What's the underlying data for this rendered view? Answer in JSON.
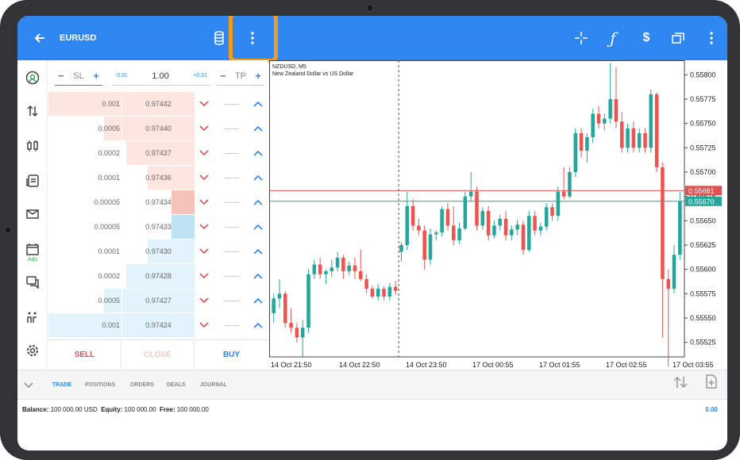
{
  "header": {
    "back_icon": "arrow-left-icon",
    "symbol": "EURUSD",
    "icons": [
      "coins-icon",
      "more-vert-icon",
      "crosshair-icon",
      "function-icon",
      "dollar-swap-icon",
      "windows-icon",
      "more-vert-icon"
    ]
  },
  "rail": {
    "icons": [
      "account-icon",
      "quotes-icon",
      "chart-icon",
      "trade-list-icon",
      "mail-icon",
      "calendar-icon",
      "chat-icon",
      "community-icon",
      "settings-icon"
    ],
    "ads_label": "Ads"
  },
  "order": {
    "sl_label": "SL",
    "tp_label": "TP",
    "minus": "−",
    "plus": "+",
    "vol_step_down": "-0.01",
    "vol_step_up": "+0.01",
    "volume": "1.00"
  },
  "book": {
    "rows": [
      {
        "volume": "0.001",
        "price": "0.97442",
        "side": "sell",
        "depth": 1.0
      },
      {
        "volume": "0.0005",
        "price": "0.97440",
        "side": "sell",
        "depth": 0.62
      },
      {
        "volume": "0.0002",
        "price": "0.97437",
        "side": "sell",
        "depth": 0.47
      },
      {
        "volume": "0.0001",
        "price": "0.97436",
        "side": "sell",
        "depth": 0.32
      },
      {
        "volume": "0.00005",
        "price": "0.97434",
        "side": "sell",
        "depth": 0.16
      },
      {
        "volume": "0.00005",
        "price": "0.97433",
        "side": "buy",
        "depth": 0.16
      },
      {
        "volume": "0.0001",
        "price": "0.97430",
        "side": "buy",
        "depth": 0.32
      },
      {
        "volume": "0.0002",
        "price": "0.97428",
        "side": "buy",
        "depth": 0.47
      },
      {
        "volume": "0.0005",
        "price": "0.97427",
        "side": "buy",
        "depth": 0.62
      },
      {
        "volume": "0.001",
        "price": "0.97424",
        "side": "buy",
        "depth": 1.0
      }
    ]
  },
  "buttons": {
    "sell": "SELL",
    "close": "CLOSE",
    "buy": "BUY"
  },
  "chart_data": {
    "type": "candlestick",
    "title": "NZDUSD, M5",
    "subtitle": "New Zealand Dollar vs US Dollar",
    "x_ticks": [
      "14 Oct 21:50",
      "14 Oct 22:50",
      "14 Oct 23:50",
      "17 Oct 00:55",
      "17 Oct 01:55",
      "17 Oct 02:55",
      "17 Oct 03:55"
    ],
    "y_ticks": [
      "0.55800",
      "0.55775",
      "0.55750",
      "0.55725",
      "0.55700",
      "0.55675",
      "0.55650",
      "0.55625",
      "0.55600",
      "0.55575",
      "0.55550",
      "0.55525"
    ],
    "ylim": [
      0.5551,
      0.55815
    ],
    "ask_line": {
      "label": "0.55681",
      "value": 0.55681,
      "color": "#e05151"
    },
    "bid_line": {
      "label": "0.55670",
      "value": 0.5567,
      "color": "#26a69a"
    },
    "session_break_index": 22,
    "colors": {
      "up": "#26a69a",
      "down": "#ef5350"
    },
    "candles": [
      [
        0.55555,
        0.55575,
        0.55545,
        0.5557
      ],
      [
        0.5557,
        0.5559,
        0.5556,
        0.55575
      ],
      [
        0.55575,
        0.55578,
        0.5554,
        0.55545
      ],
      [
        0.55545,
        0.5556,
        0.55535,
        0.5554
      ],
      [
        0.5554,
        0.55545,
        0.55525,
        0.5553
      ],
      [
        0.5553,
        0.55548,
        0.5551,
        0.5554
      ],
      [
        0.5554,
        0.556,
        0.55535,
        0.55595
      ],
      [
        0.55595,
        0.5561,
        0.5559,
        0.55605
      ],
      [
        0.55605,
        0.55612,
        0.5559,
        0.55595
      ],
      [
        0.55595,
        0.556,
        0.55585,
        0.55598
      ],
      [
        0.55598,
        0.5561,
        0.55592,
        0.55602
      ],
      [
        0.55602,
        0.55618,
        0.55598,
        0.55612
      ],
      [
        0.55612,
        0.55615,
        0.5559,
        0.55598
      ],
      [
        0.55598,
        0.55608,
        0.55594,
        0.55604
      ],
      [
        0.55604,
        0.55612,
        0.5559,
        0.55598
      ],
      [
        0.55598,
        0.5562,
        0.55588,
        0.5559
      ],
      [
        0.5559,
        0.55595,
        0.55575,
        0.5558
      ],
      [
        0.5558,
        0.55583,
        0.5557,
        0.55572
      ],
      [
        0.55572,
        0.55585,
        0.55568,
        0.5558
      ],
      [
        0.5558,
        0.55583,
        0.55568,
        0.55572
      ],
      [
        0.55572,
        0.55586,
        0.55568,
        0.55582
      ],
      [
        0.55582,
        0.55588,
        0.55574,
        0.55578
      ],
      [
        0.55618,
        0.55628,
        0.55608,
        0.55625
      ],
      [
        0.55625,
        0.5568,
        0.5562,
        0.55665
      ],
      [
        0.55665,
        0.55672,
        0.5564,
        0.55645
      ],
      [
        0.55645,
        0.55652,
        0.55635,
        0.5564
      ],
      [
        0.5564,
        0.55645,
        0.556,
        0.5561
      ],
      [
        0.5561,
        0.55642,
        0.55605,
        0.55636
      ],
      [
        0.55636,
        0.5564,
        0.5563,
        0.55638
      ],
      [
        0.55638,
        0.55665,
        0.55634,
        0.55662
      ],
      [
        0.55662,
        0.55668,
        0.5564,
        0.55645
      ],
      [
        0.55645,
        0.55665,
        0.55625,
        0.5563
      ],
      [
        0.5563,
        0.55648,
        0.55626,
        0.55642
      ],
      [
        0.55642,
        0.5568,
        0.5564,
        0.55675
      ],
      [
        0.55675,
        0.557,
        0.5567,
        0.5568
      ],
      [
        0.5568,
        0.55685,
        0.5564,
        0.55645
      ],
      [
        0.55645,
        0.55664,
        0.55641,
        0.5566
      ],
      [
        0.5566,
        0.55665,
        0.5563,
        0.55635
      ],
      [
        0.55635,
        0.5565,
        0.55632,
        0.55645
      ],
      [
        0.55645,
        0.55656,
        0.5564,
        0.55652
      ],
      [
        0.55652,
        0.5566,
        0.5563,
        0.55635
      ],
      [
        0.55635,
        0.55645,
        0.5563,
        0.55641
      ],
      [
        0.55641,
        0.55651,
        0.55635,
        0.55646
      ],
      [
        0.55646,
        0.5565,
        0.55615,
        0.5562
      ],
      [
        0.5562,
        0.5566,
        0.55618,
        0.55655
      ],
      [
        0.55655,
        0.5566,
        0.55635,
        0.5564
      ],
      [
        0.5564,
        0.55648,
        0.55635,
        0.55644
      ],
      [
        0.55644,
        0.55668,
        0.5564,
        0.55664
      ],
      [
        0.55664,
        0.55668,
        0.5565,
        0.55655
      ],
      [
        0.55655,
        0.55685,
        0.5565,
        0.5568
      ],
      [
        0.5568,
        0.55705,
        0.55672,
        0.55675
      ],
      [
        0.55675,
        0.55705,
        0.55673,
        0.557
      ],
      [
        0.557,
        0.55745,
        0.55695,
        0.5574
      ],
      [
        0.5574,
        0.55745,
        0.55715,
        0.55722
      ],
      [
        0.55722,
        0.5574,
        0.5571,
        0.55736
      ],
      [
        0.55736,
        0.55765,
        0.5573,
        0.5576
      ],
      [
        0.5576,
        0.55768,
        0.55745,
        0.5575
      ],
      [
        0.5575,
        0.5576,
        0.55743,
        0.55755
      ],
      [
        0.55755,
        0.55812,
        0.5575,
        0.55775
      ],
      [
        0.55775,
        0.55808,
        0.55745,
        0.55752
      ],
      [
        0.55752,
        0.55762,
        0.5572,
        0.55725
      ],
      [
        0.55725,
        0.5575,
        0.5572,
        0.55745
      ],
      [
        0.55745,
        0.55752,
        0.5572,
        0.55725
      ],
      [
        0.55725,
        0.55745,
        0.5572,
        0.5574
      ],
      [
        0.5574,
        0.55745,
        0.5572,
        0.55725
      ],
      [
        0.55725,
        0.55785,
        0.5572,
        0.5578
      ],
      [
        0.5578,
        0.55782,
        0.557,
        0.55705
      ],
      [
        0.55705,
        0.5571,
        0.5553,
        0.5559
      ],
      [
        0.5559,
        0.556,
        0.555,
        0.5558
      ],
      [
        0.5558,
        0.55625,
        0.55575,
        0.55615
      ],
      [
        0.55615,
        0.5568,
        0.5561,
        0.5567
      ]
    ]
  },
  "tabs": {
    "collapse_icon": "chevron-down-icon",
    "items": [
      "TRADE",
      "POSITIONS",
      "ORDERS",
      "DEALS",
      "JOURNAL"
    ],
    "active": "TRADE",
    "right_icons": [
      "sort-icon",
      "new-order-icon"
    ]
  },
  "account": {
    "balance_label": "Balance:",
    "balance": "100 000.00 USD",
    "equity_label": "Equity:",
    "equity": "100 000.00",
    "free_label": "Free:",
    "free": "100 000.00",
    "profit": "0.00"
  }
}
